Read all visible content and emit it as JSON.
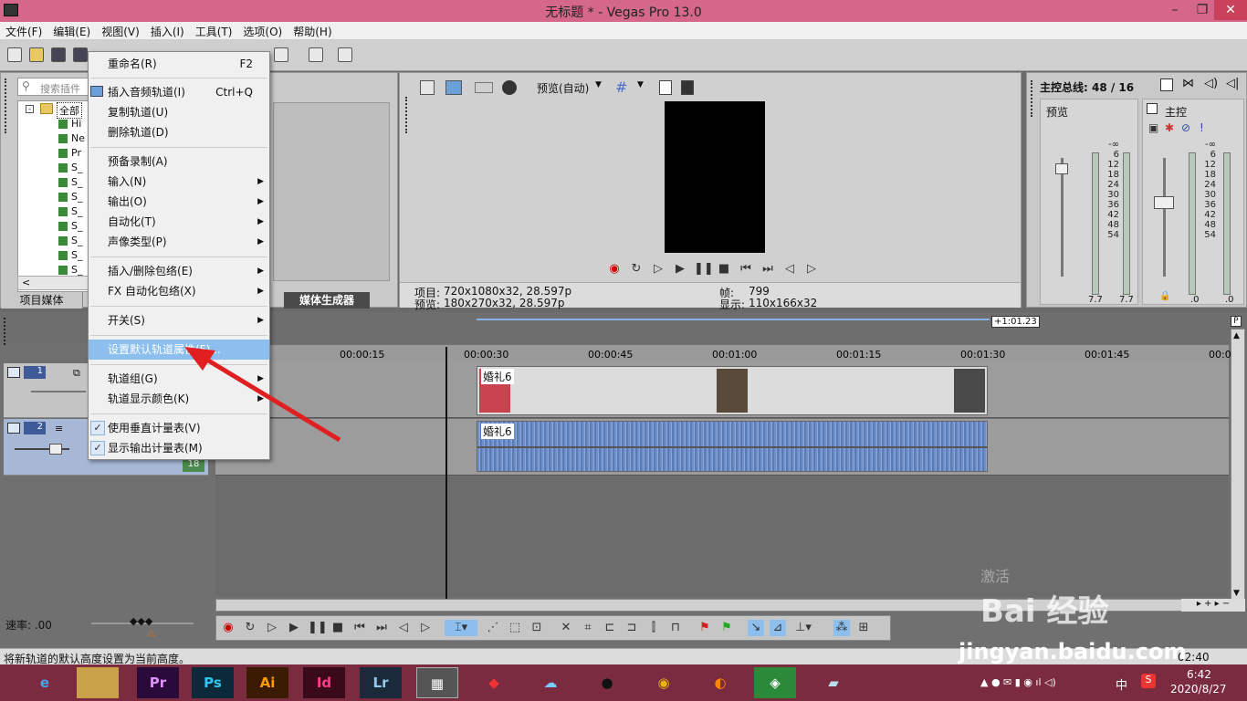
{
  "window": {
    "title": "无标题 * - Vegas Pro 13.0",
    "min": "–",
    "max": "❐",
    "close": "✕"
  },
  "menubar": [
    "文件(F)",
    "编辑(E)",
    "视图(V)",
    "插入(I)",
    "工具(T)",
    "选项(O)",
    "帮助(H)"
  ],
  "explorer": {
    "search_placeholder": "搜索插件",
    "root": "全部",
    "items": [
      "Hi",
      "Ne",
      "Pr",
      "S_",
      "S_",
      "S_",
      "S_",
      "S_",
      "S_",
      "S_",
      "S_",
      "S_"
    ],
    "tabs": [
      "项目媒体",
      "媒体生成器"
    ],
    "scroll_left": "<"
  },
  "context_menu": {
    "items": [
      {
        "label": "重命名(R)",
        "shortcut": "F2"
      },
      {
        "label": "插入音频轨道(I)",
        "shortcut": "Ctrl+Q"
      },
      {
        "label": "复制轨道(U)"
      },
      {
        "label": "删除轨道(D)"
      },
      {
        "label": "预备录制(A)"
      },
      {
        "label": "输入(N)",
        "arrow": "▶"
      },
      {
        "label": "输出(O)",
        "arrow": "▶"
      },
      {
        "label": "自动化(T)",
        "arrow": "▶"
      },
      {
        "label": "声像类型(P)",
        "arrow": "▶"
      },
      {
        "label": "插入/删除包络(E)",
        "arrow": "▶"
      },
      {
        "label": "FX 自动化包络(X)",
        "arrow": "▶"
      },
      {
        "label": "开关(S)",
        "arrow": "▶"
      },
      {
        "label": "设置默认轨道属性(F)..."
      },
      {
        "label": "轨道组(G)",
        "arrow": "▶"
      },
      {
        "label": "轨道显示颜色(K)",
        "arrow": "▶"
      },
      {
        "label": "使用垂直计量表(V)",
        "check": "✓"
      },
      {
        "label": "显示输出计量表(M)",
        "check": "✓"
      }
    ]
  },
  "preview": {
    "mode": "预览(自动)",
    "project_label": "项目:",
    "project_value": "720x1080x32, 28.597p",
    "preview_label": "预览:",
    "preview_value": "180x270x32, 28.597p",
    "frame_label": "帧:",
    "frame_value": "799",
    "display_label": "显示:",
    "display_value": "110x166x32"
  },
  "master": {
    "title": "主控总线: 48 / 16",
    "preview_label": "预览",
    "main_label": "主控",
    "scale": [
      "-∞",
      "6",
      "12",
      "18",
      "24",
      "30",
      "36",
      "42",
      "48",
      "54"
    ],
    "readouts": [
      "7.7",
      "7.7",
      ".0",
      ".0"
    ]
  },
  "timeline": {
    "end_marker": "+1:01.23",
    "ruler": [
      "00:00:15",
      "00:00:30",
      "00:00:45",
      "00:01:00",
      "00:01:15",
      "00:01:30",
      "00:01:45",
      "00:0"
    ],
    "track1_num": "1",
    "track2_num": "2",
    "track2_level": "18",
    "clip_video_label": "婚礼6",
    "clip_audio_label": "婚礼6"
  },
  "rate": {
    "label": "速率: .00"
  },
  "status": {
    "text": "将新轨道的默认高度设置为当前高度。",
    "time": "02:40"
  },
  "watermark": {
    "logo": "Bai 经验",
    "url": "jingyan.baidu.com",
    "activate": "激活"
  },
  "taskbar": {
    "apps": [
      "Pr",
      "Ps",
      "Ai",
      "Id",
      "Lr"
    ],
    "clock_time": "6:42",
    "clock_date": "2020/8/27",
    "ime": "中"
  },
  "colors": {
    "accent": "#8cbfed",
    "title": "#d5688a",
    "taskbar": "#7a2b40",
    "arrow": "#e02020"
  }
}
